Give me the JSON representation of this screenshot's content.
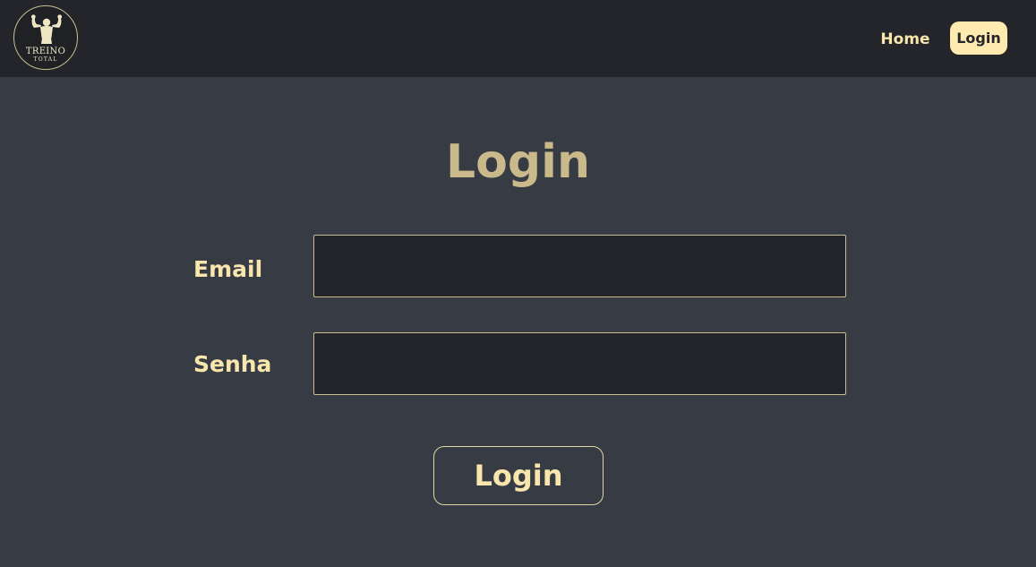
{
  "logo": {
    "line1": "TREINO",
    "line2": "TOTAL"
  },
  "nav": {
    "home_label": "Home",
    "login_label": "Login"
  },
  "main": {
    "title": "Login",
    "email_label": "Email",
    "email_value": "",
    "password_label": "Senha",
    "password_value": "",
    "submit_label": "Login"
  },
  "colors": {
    "navbar_bg": "#23252a",
    "page_bg": "#373b43",
    "accent": "#f8e6ad",
    "title": "#c9b98b"
  }
}
